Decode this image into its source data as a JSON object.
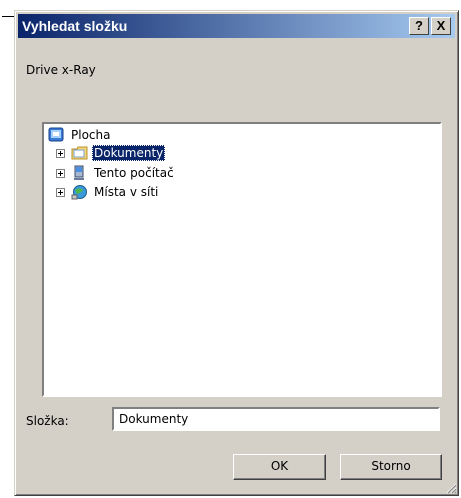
{
  "dialog": {
    "title": "Vyhledat složku",
    "help_label": "?",
    "close_label": "X",
    "description": "Drive x-Ray"
  },
  "tree": {
    "items": [
      {
        "label": "Plocha",
        "icon": "desktop-icon",
        "level": 0,
        "expandable": false,
        "selected": false
      },
      {
        "label": "Dokumenty",
        "icon": "documents-folder-icon",
        "level": 1,
        "expandable": true,
        "selected": true
      },
      {
        "label": "Tento počítač",
        "icon": "computer-icon",
        "level": 1,
        "expandable": true,
        "selected": false
      },
      {
        "label": "Místa v síti",
        "icon": "network-places-icon",
        "level": 1,
        "expandable": true,
        "selected": false
      }
    ]
  },
  "folder": {
    "label": "Složka:",
    "value": "Dokumenty"
  },
  "buttons": {
    "ok": "OK",
    "cancel": "Storno"
  },
  "colors": {
    "title_gradient_start": "#0a246a",
    "title_gradient_end": "#a6caf0",
    "face": "#d4d0c8",
    "selection": "#0a246a"
  }
}
